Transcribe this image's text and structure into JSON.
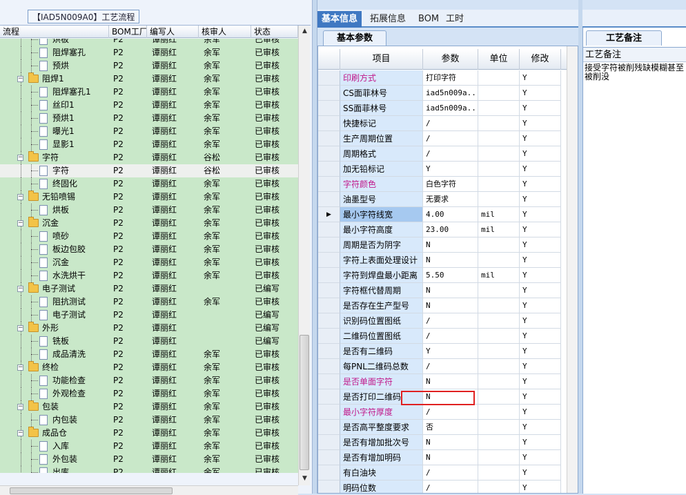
{
  "left_panel": {
    "group_title": "【IAD5N009A0】工艺流程",
    "columns": [
      "流程",
      "BOM工厂",
      "编写人",
      "核审人",
      "状态"
    ],
    "rows": [
      {
        "name": "烘板",
        "indent": 2,
        "type": "doc",
        "factory": "P2",
        "author": "谭丽红",
        "reviewer": "余军",
        "status": "已审核",
        "partial": true
      },
      {
        "name": "阻焊塞孔",
        "indent": 2,
        "type": "doc",
        "factory": "P2",
        "author": "谭丽红",
        "reviewer": "余军",
        "status": "已审核"
      },
      {
        "name": "预烘",
        "indent": 2,
        "type": "doc",
        "factory": "P2",
        "author": "谭丽红",
        "reviewer": "余军",
        "status": "已审核"
      },
      {
        "name": "阻焊1",
        "indent": 1,
        "type": "folder",
        "factory": "P2",
        "author": "谭丽红",
        "reviewer": "余军",
        "status": "已审核"
      },
      {
        "name": "阻焊塞孔1",
        "indent": 2,
        "type": "doc",
        "factory": "P2",
        "author": "谭丽红",
        "reviewer": "余军",
        "status": "已审核"
      },
      {
        "name": "丝印1",
        "indent": 2,
        "type": "doc",
        "factory": "P2",
        "author": "谭丽红",
        "reviewer": "余军",
        "status": "已审核"
      },
      {
        "name": "预烘1",
        "indent": 2,
        "type": "doc",
        "factory": "P2",
        "author": "谭丽红",
        "reviewer": "余军",
        "status": "已审核"
      },
      {
        "name": "曝光1",
        "indent": 2,
        "type": "doc",
        "factory": "P2",
        "author": "谭丽红",
        "reviewer": "余军",
        "status": "已审核"
      },
      {
        "name": "显影1",
        "indent": 2,
        "type": "doc",
        "factory": "P2",
        "author": "谭丽红",
        "reviewer": "余军",
        "status": "已审核"
      },
      {
        "name": "字符",
        "indent": 1,
        "type": "folder",
        "factory": "P2",
        "author": "谭丽红",
        "reviewer": "谷松",
        "status": "已审核"
      },
      {
        "name": "字符",
        "indent": 2,
        "type": "doc",
        "factory": "P2",
        "author": "谭丽红",
        "reviewer": "谷松",
        "status": "已审核",
        "selected": true
      },
      {
        "name": "终固化",
        "indent": 2,
        "type": "doc",
        "factory": "P2",
        "author": "谭丽红",
        "reviewer": "余军",
        "status": "已审核"
      },
      {
        "name": "无铅喷锡",
        "indent": 1,
        "type": "folder",
        "factory": "P2",
        "author": "谭丽红",
        "reviewer": "余军",
        "status": "已审核"
      },
      {
        "name": "烘板",
        "indent": 2,
        "type": "doc",
        "factory": "P2",
        "author": "谭丽红",
        "reviewer": "余军",
        "status": "已审核"
      },
      {
        "name": "沉金",
        "indent": 1,
        "type": "folder",
        "factory": "P2",
        "author": "谭丽红",
        "reviewer": "余军",
        "status": "已审核"
      },
      {
        "name": "喷砂",
        "indent": 2,
        "type": "doc",
        "factory": "P2",
        "author": "谭丽红",
        "reviewer": "余军",
        "status": "已审核"
      },
      {
        "name": "板边包胶",
        "indent": 2,
        "type": "doc",
        "factory": "P2",
        "author": "谭丽红",
        "reviewer": "余军",
        "status": "已审核"
      },
      {
        "name": "沉金",
        "indent": 2,
        "type": "doc",
        "factory": "P2",
        "author": "谭丽红",
        "reviewer": "余军",
        "status": "已审核"
      },
      {
        "name": "水洗烘干",
        "indent": 2,
        "type": "doc",
        "factory": "P2",
        "author": "谭丽红",
        "reviewer": "余军",
        "status": "已审核"
      },
      {
        "name": "电子测试",
        "indent": 1,
        "type": "folder",
        "factory": "P2",
        "author": "谭丽红",
        "reviewer": "",
        "status": "已编写"
      },
      {
        "name": "阻抗测试",
        "indent": 2,
        "type": "doc",
        "factory": "P2",
        "author": "谭丽红",
        "reviewer": "余军",
        "status": "已审核"
      },
      {
        "name": "电子测试",
        "indent": 2,
        "type": "doc",
        "factory": "P2",
        "author": "谭丽红",
        "reviewer": "",
        "status": "已编写"
      },
      {
        "name": "外形",
        "indent": 1,
        "type": "folder",
        "factory": "P2",
        "author": "谭丽红",
        "reviewer": "",
        "status": "已编写"
      },
      {
        "name": "铣板",
        "indent": 2,
        "type": "doc",
        "factory": "P2",
        "author": "谭丽红",
        "reviewer": "",
        "status": "已编写"
      },
      {
        "name": "成品清洗",
        "indent": 2,
        "type": "doc",
        "factory": "P2",
        "author": "谭丽红",
        "reviewer": "余军",
        "status": "已审核"
      },
      {
        "name": "终检",
        "indent": 1,
        "type": "folder",
        "factory": "P2",
        "author": "谭丽红",
        "reviewer": "余军",
        "status": "已审核"
      },
      {
        "name": "功能检查",
        "indent": 2,
        "type": "doc",
        "factory": "P2",
        "author": "谭丽红",
        "reviewer": "余军",
        "status": "已审核"
      },
      {
        "name": "外观检查",
        "indent": 2,
        "type": "doc",
        "factory": "P2",
        "author": "谭丽红",
        "reviewer": "余军",
        "status": "已审核"
      },
      {
        "name": "包装",
        "indent": 1,
        "type": "folder",
        "factory": "P2",
        "author": "谭丽红",
        "reviewer": "余军",
        "status": "已审核"
      },
      {
        "name": "内包装",
        "indent": 2,
        "type": "doc",
        "factory": "P2",
        "author": "谭丽红",
        "reviewer": "余军",
        "status": "已审核"
      },
      {
        "name": "成品仓",
        "indent": 1,
        "type": "folder",
        "factory": "P2",
        "author": "谭丽红",
        "reviewer": "余军",
        "status": "已审核"
      },
      {
        "name": "入库",
        "indent": 2,
        "type": "doc",
        "factory": "P2",
        "author": "谭丽红",
        "reviewer": "余军",
        "status": "已审核"
      },
      {
        "name": "外包装",
        "indent": 2,
        "type": "doc",
        "factory": "P2",
        "author": "谭丽红",
        "reviewer": "余军",
        "status": "已审核"
      },
      {
        "name": "出库",
        "indent": 2,
        "type": "doc",
        "factory": "P2",
        "author": "谭丽红",
        "reviewer": "余军",
        "status": "已审核"
      }
    ]
  },
  "right_panel": {
    "tabs": [
      {
        "label": "基本信息",
        "active": true
      },
      {
        "label": "拓展信息",
        "active": false
      },
      {
        "label": "BOM",
        "active": false
      },
      {
        "label": "工时",
        "active": false
      }
    ],
    "subtab": "基本参数",
    "columns": [
      "项目",
      "参数",
      "单位",
      "修改"
    ],
    "rows": [
      {
        "item": "印刷方式",
        "value": "打印字符",
        "unit": "",
        "edit": "Y",
        "pink": true
      },
      {
        "item": "CS面菲林号",
        "value": "iad5n009a...",
        "unit": "",
        "edit": "Y"
      },
      {
        "item": "SS面菲林号",
        "value": "iad5n009a...",
        "unit": "",
        "edit": "Y"
      },
      {
        "item": "快捷标记",
        "value": "/",
        "unit": "",
        "edit": "Y"
      },
      {
        "item": "生产周期位置",
        "value": "/",
        "unit": "",
        "edit": "Y"
      },
      {
        "item": "周期格式",
        "value": "/",
        "unit": "",
        "edit": "Y"
      },
      {
        "item": "加无铅标记",
        "value": "Y",
        "unit": "",
        "edit": "Y"
      },
      {
        "item": "字符颜色",
        "value": "白色字符",
        "unit": "",
        "edit": "Y",
        "pink": true
      },
      {
        "item": "油墨型号",
        "value": "无要求",
        "unit": "",
        "edit": "Y"
      },
      {
        "item": "最小字符线宽",
        "value": "4.00",
        "unit": "mil",
        "edit": "Y",
        "current": true
      },
      {
        "item": "最小字符高度",
        "value": "23.00",
        "unit": "mil",
        "edit": "Y"
      },
      {
        "item": "周期是否为阴字",
        "value": "N",
        "unit": "",
        "edit": "Y"
      },
      {
        "item": "字符上表面处理设计",
        "value": "N",
        "unit": "",
        "edit": "Y"
      },
      {
        "item": "字符到焊盘最小距离",
        "value": "5.50",
        "unit": "mil",
        "edit": "Y"
      },
      {
        "item": "字符框代替周期",
        "value": "N",
        "unit": "",
        "edit": "Y"
      },
      {
        "item": "是否存在生产型号",
        "value": "N",
        "unit": "",
        "edit": "Y"
      },
      {
        "item": "识别码位置图纸",
        "value": "/",
        "unit": "",
        "edit": "Y"
      },
      {
        "item": "二维码位置图纸",
        "value": "/",
        "unit": "",
        "edit": "Y"
      },
      {
        "item": "是否有二维码",
        "value": "Y",
        "unit": "",
        "edit": "Y",
        "highlighted": true
      },
      {
        "item": "每PNL二维码总数",
        "value": "/",
        "unit": "",
        "edit": "Y"
      },
      {
        "item": "是否单面字符",
        "value": "N",
        "unit": "",
        "edit": "Y",
        "pink": true
      },
      {
        "item": "是否打印二维码",
        "value": "N",
        "unit": "",
        "edit": "Y"
      },
      {
        "item": "最小字符厚度",
        "value": "/",
        "unit": "",
        "edit": "Y",
        "pink": true
      },
      {
        "item": "是否高平整度要求",
        "value": "否",
        "unit": "",
        "edit": "Y"
      },
      {
        "item": "是否有增加批次号",
        "value": "N",
        "unit": "",
        "edit": "Y"
      },
      {
        "item": "是否有增加明码",
        "value": "N",
        "unit": "",
        "edit": "Y"
      },
      {
        "item": "有白油块",
        "value": "/",
        "unit": "",
        "edit": "Y"
      },
      {
        "item": "明码位数",
        "value": "/",
        "unit": "",
        "edit": "Y"
      }
    ]
  },
  "notes_panel": {
    "tab_label": "工艺备注",
    "header": "工艺备注",
    "text": "接受字符被削残缺模糊甚至被削没"
  },
  "icons": {
    "expand": "minus-box-icon",
    "folder": "folder-icon",
    "document": "document-icon",
    "row_indicator": "row-pointer-icon"
  },
  "colors": {
    "tree_bg": "#c9e8c9",
    "active_tab": "#3f78c2",
    "item_cell": "#d8e9fb",
    "pink_text": "#c0188a",
    "highlight_border": "#e02020"
  }
}
